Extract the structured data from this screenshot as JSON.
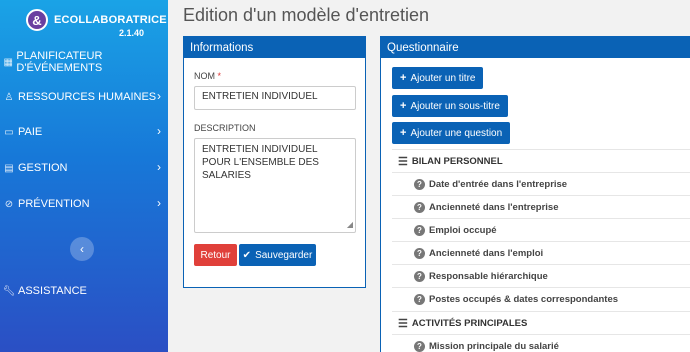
{
  "brand": {
    "logo_glyph": "&",
    "name": "ECOLLABORATRICE",
    "version": "2.1.40"
  },
  "sidebar": {
    "items": [
      {
        "label": "PLANIFICATEUR D'ÉVÉNEMENTS",
        "icon": "calendar-icon",
        "has_chevron": false
      },
      {
        "label": "RESSOURCES HUMAINES",
        "icon": "user-icon",
        "has_chevron": true
      },
      {
        "label": "PAIE",
        "icon": "card-icon",
        "has_chevron": true
      },
      {
        "label": "GESTION",
        "icon": "document-icon",
        "has_chevron": true
      },
      {
        "label": "PRÉVENTION",
        "icon": "ban-icon",
        "has_chevron": true
      },
      {
        "label": "ASSISTANCE",
        "icon": "wrench-icon",
        "has_chevron": false
      }
    ],
    "collapse_glyph": "‹"
  },
  "page": {
    "title": "Edition d'un modèle d'entretien"
  },
  "info_panel": {
    "title": "Informations",
    "nom_label": "NOM",
    "required_mark": "*",
    "nom_value": "ENTRETIEN INDIVIDUEL",
    "description_label": "DESCRIPTION",
    "description_value": "ENTRETIEN INDIVIDUEL POUR L'ENSEMBLE DES SALARIES",
    "cancel_label": "Retour",
    "save_label": "Sauvegarder"
  },
  "questionnaire": {
    "title": "Questionnaire",
    "add_title_label": "Ajouter un titre",
    "add_subtitle_label": "Ajouter un sous-titre",
    "add_question_label": "Ajouter une question",
    "rows": [
      {
        "type": "section",
        "label": "BILAN PERSONNEL"
      },
      {
        "type": "item",
        "label": "Date d'entrée dans l'entreprise"
      },
      {
        "type": "item",
        "label": "Ancienneté dans l'entreprise"
      },
      {
        "type": "item",
        "label": "Emploi occupé"
      },
      {
        "type": "item",
        "label": "Ancienneté dans l'emploi"
      },
      {
        "type": "item",
        "label": "Responsable hiérarchique"
      },
      {
        "type": "item",
        "label": "Postes occupés & dates correspondantes"
      },
      {
        "type": "section",
        "label": "ACTIVITÉS PRINCIPALES"
      },
      {
        "type": "item",
        "label": "Mission principale du salarié"
      }
    ]
  },
  "colors": {
    "primary": "#0a62b5",
    "danger": "#e0403a",
    "sidebar_top": "#1aa3e6",
    "sidebar_bottom": "#2b4fc4"
  }
}
